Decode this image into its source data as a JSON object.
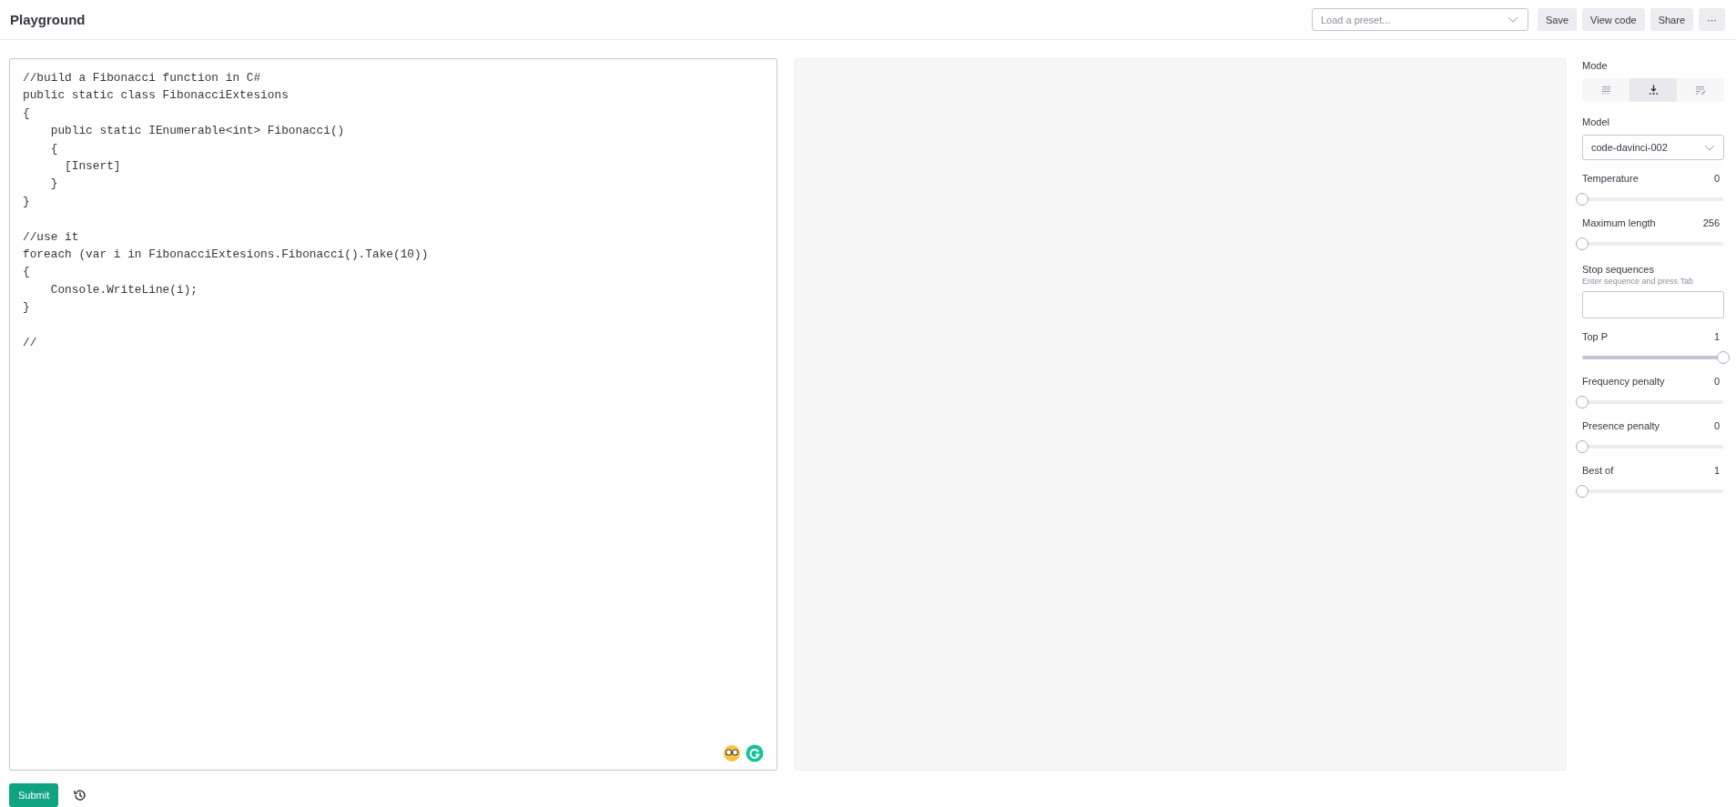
{
  "header": {
    "title": "Playground",
    "preset": {
      "placeholder": "Load a preset..."
    },
    "buttons": [
      "Save",
      "View code",
      "Share",
      "···"
    ]
  },
  "editor": {
    "blocks": [
      [
        "//build a Fibonacci function in C#",
        "public static class FibonacciExtesions",
        "{",
        "    public static IEnumerable<int> Fibonacci()",
        "    {",
        "      [Insert]",
        "    }",
        "}"
      ],
      [
        "//use it",
        "foreach (var i in FibonacciExtesions.Fibonacci().Take(10))",
        "{",
        "    Console.WriteLine(i);",
        "}"
      ],
      [
        "//"
      ]
    ]
  },
  "footer": {
    "submit": "Submit"
  },
  "settings": {
    "mode": {
      "label": "Mode",
      "options": [
        {
          "kind": "complete",
          "selected": false
        },
        {
          "kind": "insert",
          "selected": true
        },
        {
          "kind": "edit",
          "selected": false
        }
      ]
    },
    "model": {
      "label": "Model",
      "value": "code-davinci-002"
    },
    "sliders_a": [
      {
        "label": "Temperature",
        "reading": "0",
        "level": 0
      },
      {
        "label": "Maximum length",
        "reading": "256",
        "level": 0
      }
    ],
    "stop": {
      "label": "Stop sequences",
      "hint": "Enter sequence and press Tab"
    },
    "sliders_b": [
      {
        "label": "Top P",
        "reading": "1",
        "level": 1
      },
      {
        "label": "Frequency penalty",
        "reading": "0",
        "level": 0
      },
      {
        "label": "Presence penalty",
        "reading": "0",
        "level": 0
      },
      {
        "label": "Best of",
        "reading": "1",
        "level": 0
      }
    ]
  }
}
